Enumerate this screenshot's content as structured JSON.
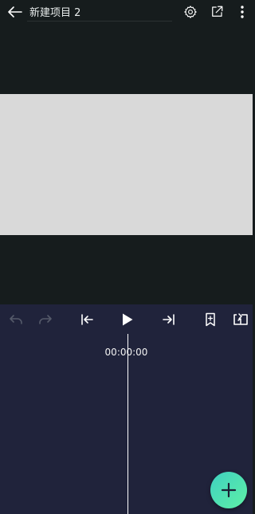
{
  "header": {
    "title": "新建项目 2",
    "back_icon": "arrow-left-icon",
    "settings_icon": "gear-icon",
    "export_icon": "export-icon",
    "more_icon": "more-vertical-icon"
  },
  "preview": {
    "canvas_color": "#d9d9d9",
    "background_color": "#161c1d"
  },
  "timeline": {
    "toolbar": {
      "undo_icon": "undo-icon",
      "redo_icon": "redo-icon",
      "skip_start_icon": "skip-to-start-icon",
      "play_icon": "play-icon",
      "skip_end_icon": "skip-to-end-icon",
      "bookmark_icon": "bookmark-icon",
      "loop_icon": "loop-icon"
    },
    "timecode": "00:00:00",
    "background_color": "#20233b",
    "add_icon": "plus-icon"
  },
  "colors": {
    "accent_start": "#3fd0c0",
    "accent_end": "#5ef0a6",
    "icon_active": "#ffffff",
    "icon_disabled": "#555a6a"
  }
}
